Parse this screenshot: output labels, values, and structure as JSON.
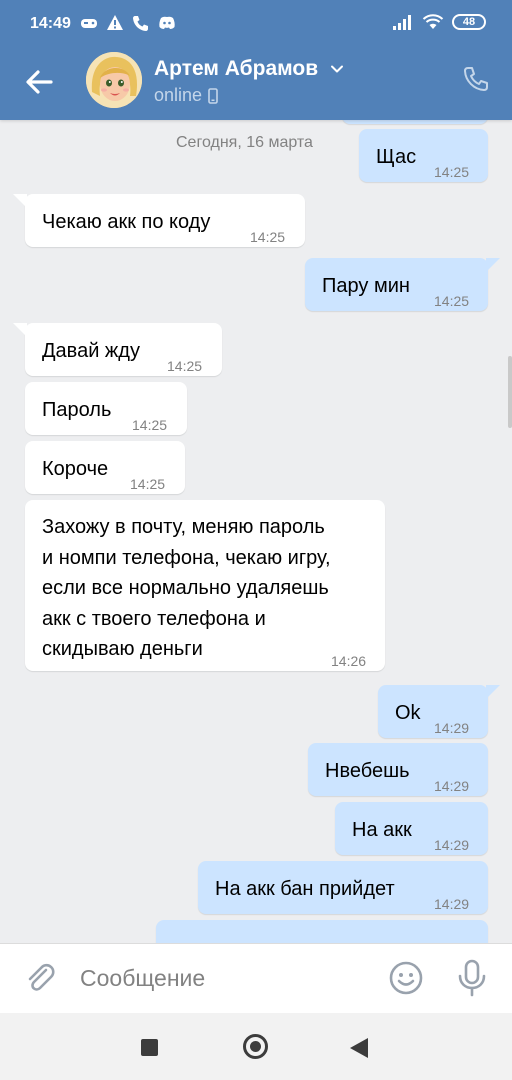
{
  "status_bar": {
    "time": "14:49",
    "battery": "48"
  },
  "header": {
    "name": "Артем Абрамов",
    "status": "online"
  },
  "chat": {
    "date_separator": "Сегодня, 16 марта",
    "messages": [
      {
        "direction": "out",
        "text": "Щас",
        "time": "14:25"
      },
      {
        "direction": "in",
        "text": "Чекаю акк по коду",
        "time": "14:25"
      },
      {
        "direction": "out",
        "text": "Пару мин",
        "time": "14:25"
      },
      {
        "direction": "in",
        "text": "Давай жду",
        "time": "14:25"
      },
      {
        "direction": "in",
        "text": "Пароль",
        "time": "14:25"
      },
      {
        "direction": "in",
        "text": "Короче",
        "time": "14:25"
      },
      {
        "direction": "in",
        "lines": [
          "Захожу в почту, меняю пароль",
          "и номпи телефона, чекаю игру,",
          "если все нормально удаляешь",
          "акк с твоего телефона и",
          "скидываю деньги"
        ],
        "time": "14:26"
      },
      {
        "direction": "out",
        "text": "Ok",
        "time": "14:29"
      },
      {
        "direction": "out",
        "text": "Нвебешь",
        "time": "14:29"
      },
      {
        "direction": "out",
        "text": "На акк",
        "time": "14:29"
      },
      {
        "direction": "out",
        "text": "На акк бан прийдет",
        "time": "14:29"
      }
    ]
  },
  "composer": {
    "placeholder": "Сообщение"
  },
  "colors": {
    "header": "#5181b8",
    "outgoing_bubble": "#cce4ff",
    "incoming_bubble": "#ffffff",
    "background": "#edeef0"
  },
  "icons": [
    "back-arrow-icon",
    "chevron-down-icon",
    "phone-icon",
    "mobile-icon",
    "attach-icon",
    "emoji-icon",
    "mic-icon"
  ]
}
